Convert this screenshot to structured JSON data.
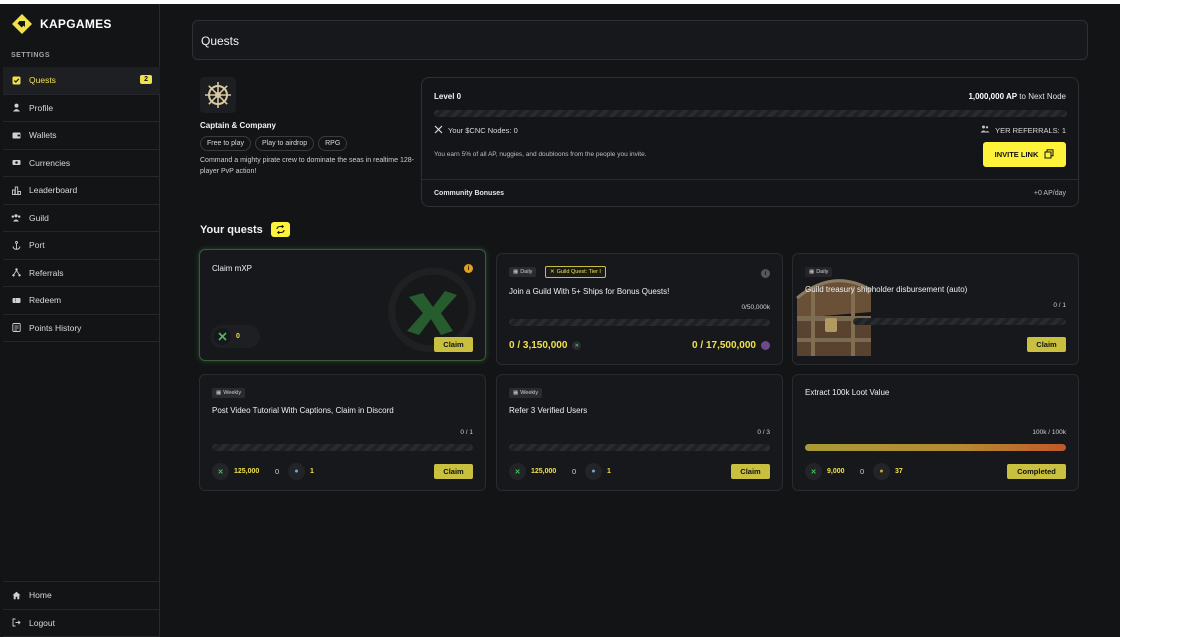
{
  "app": {
    "brand": "KAPGAMES"
  },
  "sidebar": {
    "section_label": "SETTINGS",
    "items": [
      {
        "label": "Quests",
        "icon": "quests-icon",
        "badge": "2",
        "active": true
      },
      {
        "label": "Profile",
        "icon": "profile-icon"
      },
      {
        "label": "Wallets",
        "icon": "wallet-icon"
      },
      {
        "label": "Currencies",
        "icon": "currency-icon"
      },
      {
        "label": "Leaderboard",
        "icon": "leaderboard-icon"
      },
      {
        "label": "Guild",
        "icon": "guild-icon"
      },
      {
        "label": "Port",
        "icon": "anchor-icon"
      },
      {
        "label": "Referrals",
        "icon": "referrals-icon"
      },
      {
        "label": "Redeem",
        "icon": "ticket-icon"
      },
      {
        "label": "Points History",
        "icon": "history-icon"
      }
    ],
    "bottom_items": [
      {
        "label": "Home",
        "icon": "home-icon"
      },
      {
        "label": "Logout",
        "icon": "logout-icon"
      }
    ]
  },
  "page": {
    "title": "Quests"
  },
  "game": {
    "name": "Captain & Company",
    "tags": [
      "Free to play",
      "Play to airdrop",
      "RPG"
    ],
    "description": "Command a mighty pirate crew to dominate the seas in realtime 128-player PvP action!"
  },
  "level": {
    "title": "Level 0",
    "next_amount": "1,000,000 AP",
    "next_suffix": " to Next Node",
    "progress": 0,
    "nodes": "Your $CNC Nodes: 0",
    "referrals": "YER REFERRALS: 1",
    "earn_text": "You earn 5% of all AP, nuggies, and doubloons from the people you invite.",
    "invite_label": "INVITE LINK",
    "community_label": "Community Bonuses",
    "community_value": "+0 AP/day"
  },
  "quests_section": {
    "title": "Your quests"
  },
  "quests": [
    {
      "title": "Claim mXP",
      "reward_amount": "0",
      "button": "Claim"
    },
    {
      "tag": "Daily",
      "guild_tag": "Guild Quest: Tier I",
      "title": "Join a Guild With 5+ Ships for Bonus Quests!",
      "count": "0/50,000k",
      "progress": 0,
      "amount_left": "0 / 3,150,000",
      "amount_right": "0 / 17,500,000"
    },
    {
      "tag": "Daily",
      "title": "Guild treasury shipholder disbursement (auto)",
      "count": "0 / 1",
      "progress": 0,
      "button": "Claim"
    },
    {
      "tag": "Weekly",
      "title": "Post Video Tutorial With Captions, Claim in Discord",
      "count": "0 / 1",
      "progress": 0,
      "reward_1": "125,000",
      "reward_2": "0",
      "reward_3": "1",
      "button": "Claim"
    },
    {
      "tag": "Weekly",
      "title": "Refer 3 Verified Users",
      "count": "0 / 3",
      "progress": 0,
      "reward_1": "125,000",
      "reward_2": "0",
      "reward_3": "1",
      "button": "Claim"
    },
    {
      "title": "Extract 100k Loot Value",
      "count": "100k / 100k",
      "progress": 1,
      "reward_1": "9,000",
      "reward_2": "0",
      "reward_3": "37",
      "button": "Completed"
    }
  ],
  "colors": {
    "accent": "#fff23a",
    "claim": "#c8c03e",
    "bg": "#131416",
    "card": "#17181b"
  }
}
